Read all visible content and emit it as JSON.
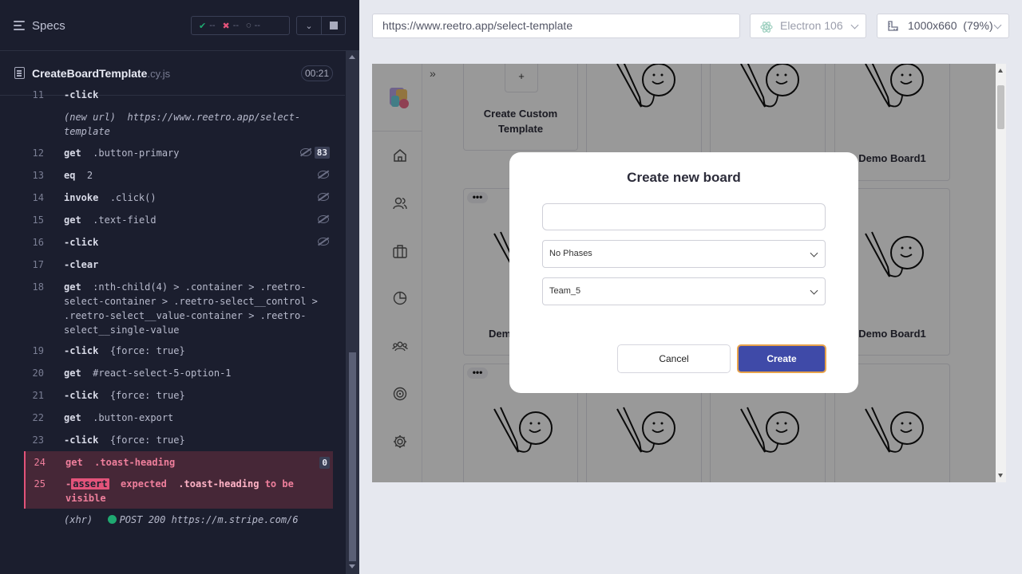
{
  "runner": {
    "specs_label": "Specs",
    "stats": {
      "passed": "--",
      "failed": "--",
      "pending": "--"
    },
    "spec_file": {
      "name": "CreateBoardTemplate",
      "ext": ".cy.js"
    },
    "duration": "00:21",
    "commands": [
      {
        "num": "11",
        "cmd": "-click",
        "arg": ""
      },
      {
        "num": "",
        "cmd": "(new url)",
        "arg": "https://www.reetro.app/select-",
        "arg2": "template"
      },
      {
        "num": "12",
        "cmd": "get",
        "arg": ".button-primary",
        "badge": "83"
      },
      {
        "num": "13",
        "cmd": "eq",
        "arg": "2"
      },
      {
        "num": "14",
        "cmd": "invoke",
        "arg": ".click()"
      },
      {
        "num": "15",
        "cmd": "get",
        "arg": ".text-field"
      },
      {
        "num": "16",
        "cmd": "-click",
        "arg": ""
      },
      {
        "num": "17",
        "cmd": "-clear",
        "arg": ""
      },
      {
        "num": "18",
        "cmd": "get",
        "arg": ":nth-child(4) > .container > .reetro-",
        "arg2": "select-container > .reetro-select__control >",
        "arg3": ".reetro-select__value-container > .reetro-",
        "arg4": "select__single-value"
      },
      {
        "num": "19",
        "cmd": "-click",
        "arg": "{force: true}"
      },
      {
        "num": "20",
        "cmd": "get",
        "arg": "#react-select-5-option-1"
      },
      {
        "num": "21",
        "cmd": "-click",
        "arg": "{force: true}"
      },
      {
        "num": "22",
        "cmd": "get",
        "arg": ".button-export"
      },
      {
        "num": "23",
        "cmd": "-click",
        "arg": "{force: true}"
      },
      {
        "num": "24",
        "cmd": "get",
        "arg": ".toast-heading",
        "badge": "0"
      },
      {
        "num": "25",
        "cmd": "-",
        "assert": "assert",
        "expected": "expected",
        "subject": ".toast-heading",
        "tail": "to be",
        "tail2": "visible"
      },
      {
        "num": "",
        "cmd": "(xhr)",
        "arg": "POST 200 https://m.stripe.com/6"
      }
    ]
  },
  "browser": {
    "url": "https://www.reetro.app/select-template",
    "browser_name": "Electron 106",
    "viewport": "1000x660",
    "zoom": "(79%)"
  },
  "app": {
    "expand_glyph": "»",
    "plus_glyph": "+",
    "custom_template_label": "Create Custom Template",
    "board_labels": [
      "Demo Board1",
      "Demo Board1",
      "Dem"
    ],
    "dots_glyph": "•••",
    "modal": {
      "title": "Create new board",
      "name_value": "",
      "phases_value": "No Phases",
      "team_value": "Team_5",
      "cancel_label": "Cancel",
      "create_label": "Create"
    },
    "colors": {
      "primary": "#3f4aa8",
      "focus_ring": "#e8a34b",
      "error": "#e3537a"
    }
  }
}
